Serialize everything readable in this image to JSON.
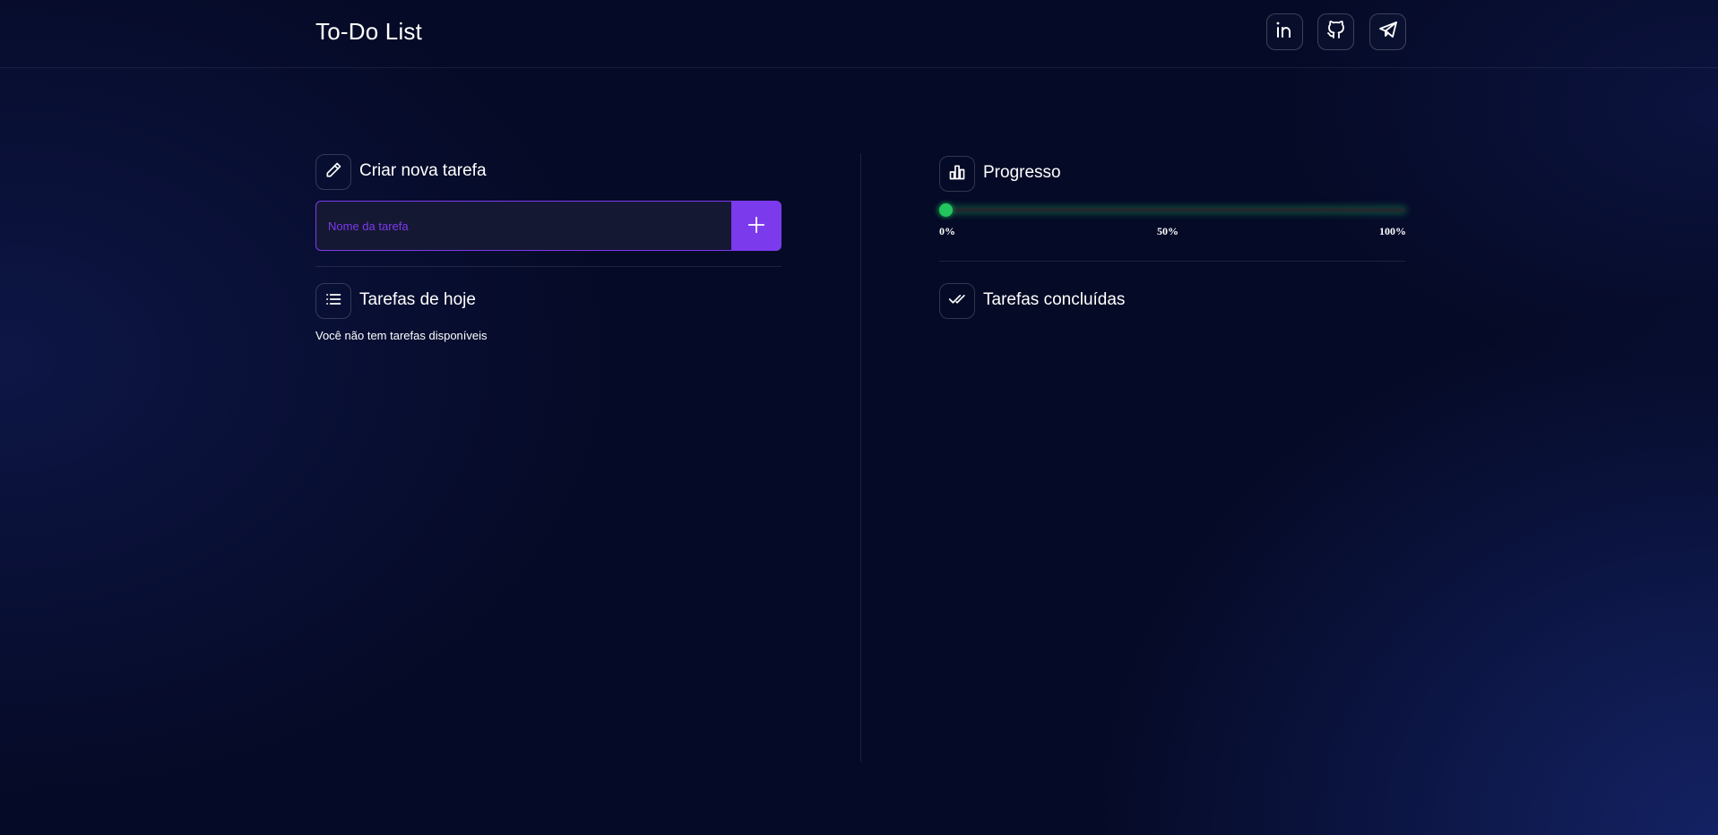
{
  "header": {
    "title": "To-Do List",
    "links": [
      {
        "icon": "linkedin-icon"
      },
      {
        "icon": "github-icon"
      },
      {
        "icon": "telegram-icon"
      }
    ]
  },
  "create_task": {
    "title": "Criar nova tarefa",
    "icon": "pencil-icon",
    "input_placeholder": "Nome da tarefa",
    "input_value": "",
    "add_icon": "plus-icon"
  },
  "today_tasks": {
    "title": "Tarefas de hoje",
    "icon": "list-icon",
    "empty_message": "Você não tem tarefas disponíveis"
  },
  "progress": {
    "title": "Progresso",
    "icon": "bar-chart-icon",
    "value_percent": 0,
    "ticks": [
      "0%",
      "50%",
      "100%"
    ]
  },
  "completed_tasks": {
    "title": "Tarefas concluídas",
    "icon": "double-check-icon"
  },
  "colors": {
    "background": "#050a26",
    "accent": "#7c3aed",
    "progress": "#22c55e",
    "text": "#ffffff"
  }
}
